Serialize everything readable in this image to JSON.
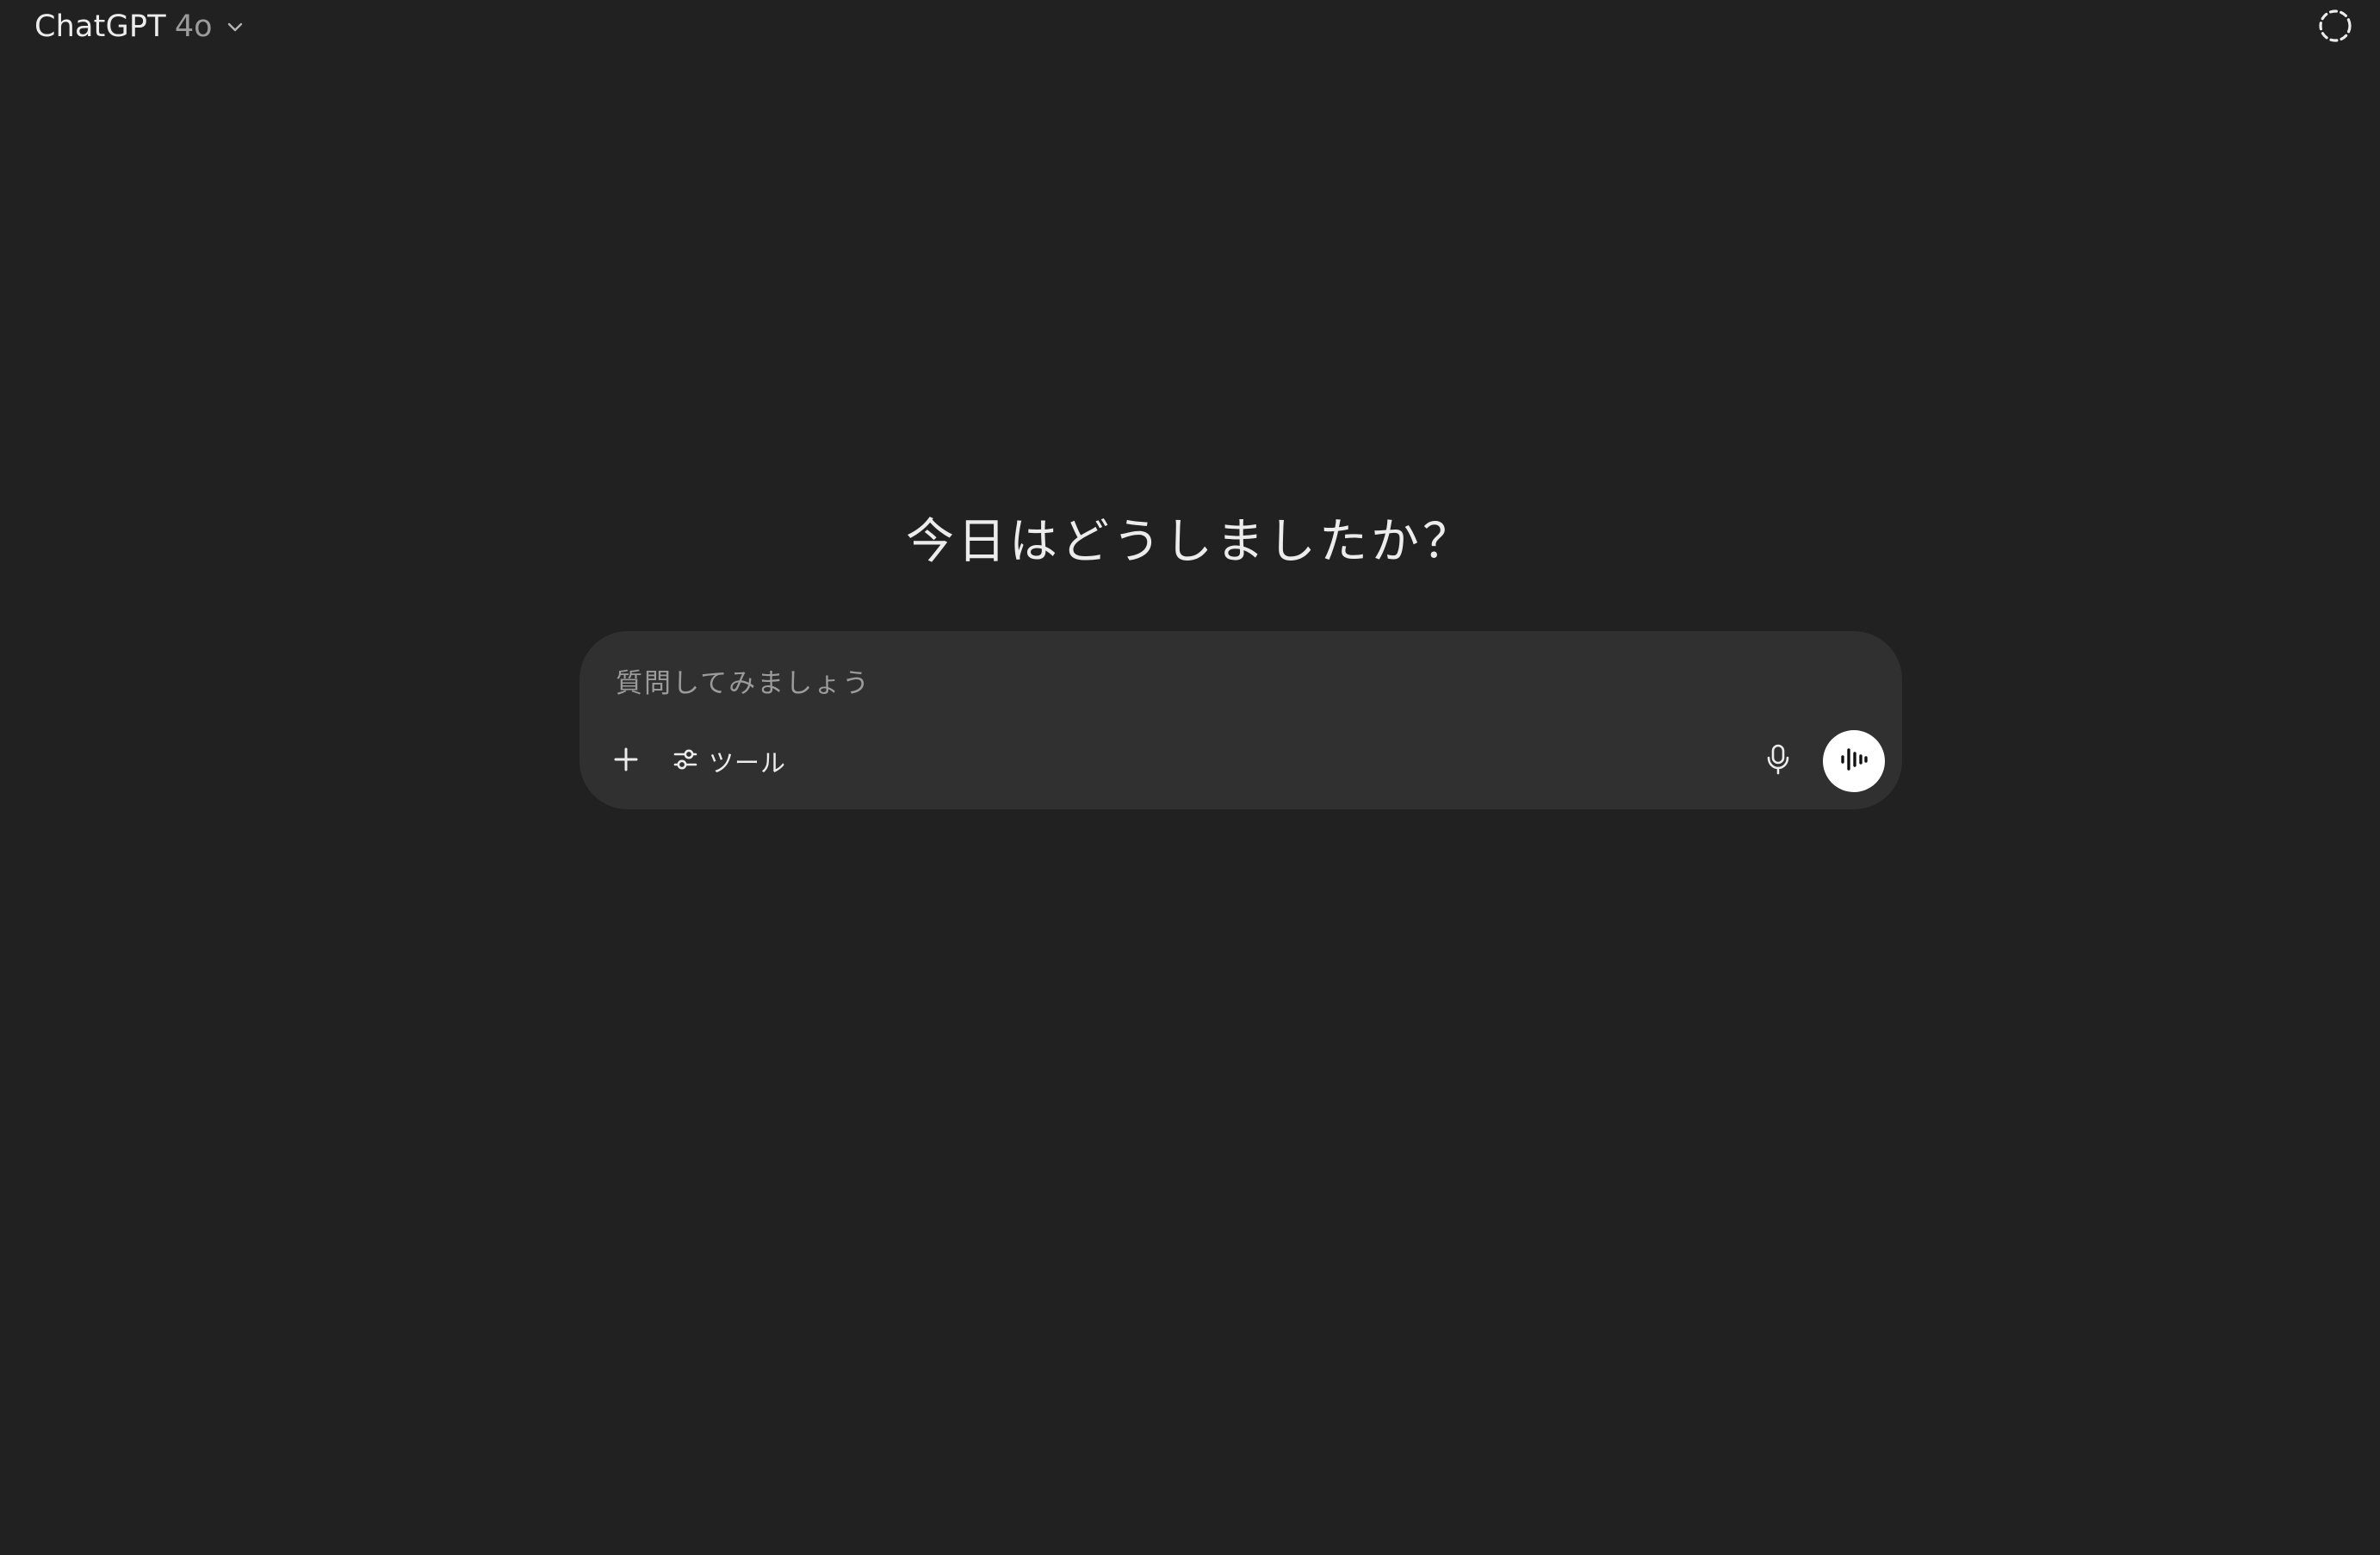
{
  "header": {
    "model_name": "ChatGPT",
    "model_version": "4o",
    "model_dropdown_icon": "chevron-down-icon",
    "temporary_chat_icon": "dashed-circle-icon"
  },
  "main": {
    "greeting": "今日はどうしましたか？"
  },
  "composer": {
    "placeholder": "質問してみましょう",
    "value": "",
    "add_icon": "plus-icon",
    "tools_icon": "sliders-icon",
    "tools_label": "ツール",
    "dictate_icon": "microphone-icon",
    "voice_icon": "voice-waveform-icon"
  },
  "colors": {
    "background": "#212121",
    "composer_background": "#303030",
    "text_primary": "#ececec",
    "text_secondary": "#9b9b9b",
    "voice_button_background": "#ffffff"
  }
}
